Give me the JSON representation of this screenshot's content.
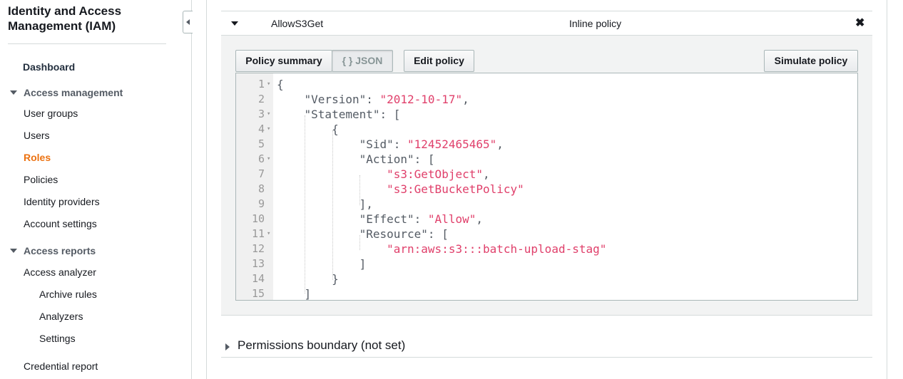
{
  "sidebar": {
    "title": "Identity and Access Management (IAM)",
    "dashboard": "Dashboard",
    "access_management": "Access management",
    "access_management_items": [
      "User groups",
      "Users",
      "Roles",
      "Policies",
      "Identity providers",
      "Account settings"
    ],
    "active_item": "Roles",
    "access_reports": "Access reports",
    "access_reports_items": [
      "Access analyzer",
      "Archive rules",
      "Analyzers",
      "Settings",
      "Credential report"
    ]
  },
  "policy": {
    "name": "AllowS3Get",
    "type": "Inline policy",
    "close_icon": "✖",
    "tabs": {
      "summary": "Policy summary",
      "json": "{ } JSON"
    },
    "edit_label": "Edit policy",
    "simulate_label": "Simulate policy",
    "code_lines": [
      {
        "n": "1",
        "fold": true,
        "parts": [
          {
            "t": "{",
            "c": "key"
          }
        ]
      },
      {
        "n": "2",
        "fold": false,
        "parts": [
          {
            "t": "    \"Version\": ",
            "c": "key"
          },
          {
            "t": "\"2012-10-17\"",
            "c": "str"
          },
          {
            "t": ",",
            "c": "key"
          }
        ]
      },
      {
        "n": "3",
        "fold": true,
        "parts": [
          {
            "t": "    \"Statement\": [",
            "c": "key"
          }
        ]
      },
      {
        "n": "4",
        "fold": true,
        "parts": [
          {
            "t": "        {",
            "c": "key"
          }
        ]
      },
      {
        "n": "5",
        "fold": false,
        "parts": [
          {
            "t": "            \"Sid\": ",
            "c": "key"
          },
          {
            "t": "\"12452465465\"",
            "c": "str"
          },
          {
            "t": ",",
            "c": "key"
          }
        ]
      },
      {
        "n": "6",
        "fold": true,
        "parts": [
          {
            "t": "            \"Action\": [",
            "c": "key"
          }
        ]
      },
      {
        "n": "7",
        "fold": false,
        "parts": [
          {
            "t": "                ",
            "c": "key"
          },
          {
            "t": "\"s3:GetObject\"",
            "c": "str"
          },
          {
            "t": ",",
            "c": "key"
          }
        ]
      },
      {
        "n": "8",
        "fold": false,
        "parts": [
          {
            "t": "                ",
            "c": "key"
          },
          {
            "t": "\"s3:GetBucketPolicy\"",
            "c": "str"
          }
        ]
      },
      {
        "n": "9",
        "fold": false,
        "parts": [
          {
            "t": "            ],",
            "c": "key"
          }
        ]
      },
      {
        "n": "10",
        "fold": false,
        "parts": [
          {
            "t": "            \"Effect\": ",
            "c": "key"
          },
          {
            "t": "\"Allow\"",
            "c": "str"
          },
          {
            "t": ",",
            "c": "key"
          }
        ]
      },
      {
        "n": "11",
        "fold": true,
        "parts": [
          {
            "t": "            \"Resource\": [",
            "c": "key"
          }
        ]
      },
      {
        "n": "12",
        "fold": false,
        "parts": [
          {
            "t": "                ",
            "c": "key"
          },
          {
            "t": "\"arn:aws:s3:::batch-upload-stag\"",
            "c": "str"
          }
        ]
      },
      {
        "n": "13",
        "fold": false,
        "parts": [
          {
            "t": "            ]",
            "c": "key"
          }
        ]
      },
      {
        "n": "14",
        "fold": false,
        "parts": [
          {
            "t": "        }",
            "c": "key"
          }
        ]
      },
      {
        "n": "15",
        "fold": false,
        "parts": [
          {
            "t": "    ]",
            "c": "key"
          }
        ]
      }
    ]
  },
  "permissions_boundary": "Permissions boundary (not set)"
}
